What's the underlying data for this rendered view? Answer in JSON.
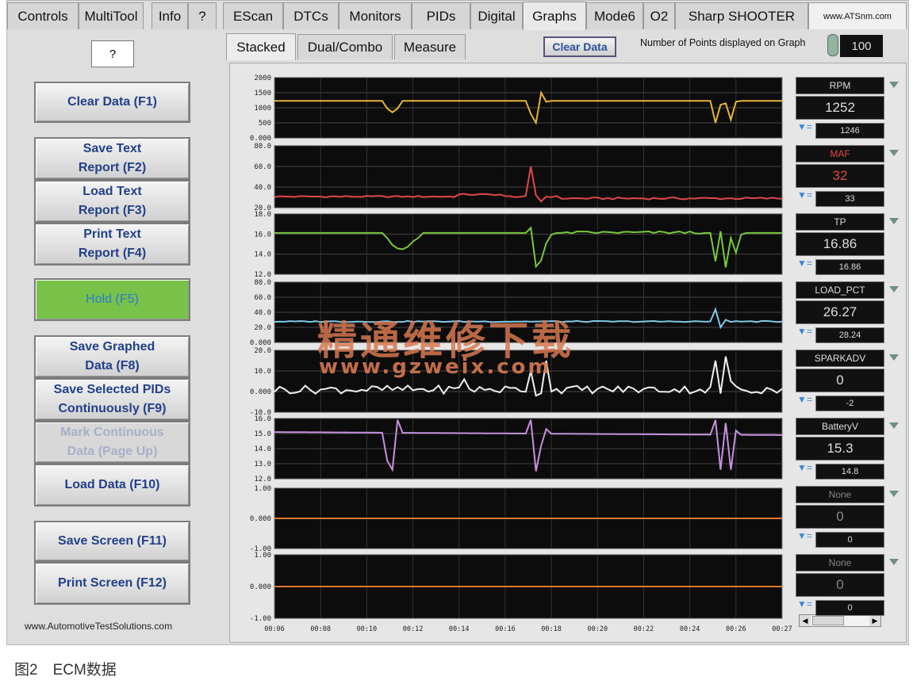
{
  "tabs": [
    "Controls",
    "MultiTool",
    "Info",
    "?",
    "EScan",
    "DTCs",
    "Monitors",
    "PIDs",
    "Digital",
    "Graphs",
    "Mode6",
    "O2",
    "Sharp SHOOTER",
    "www.ATSnm.com"
  ],
  "subtabs": [
    "Stacked",
    "Dual/Combo",
    "Measure"
  ],
  "clear_data_btn": "Clear Data",
  "points_label": "Number of Points displayed on Graph",
  "points_value": "100",
  "help_box": "?",
  "left_buttons": [
    "Clear Data (F1)",
    "Save Text\nReport (F2)",
    "Load Text\nReport (F3)",
    "Print Text\nReport (F4)",
    "Hold (F5)",
    "Save Graphed\nData (F8)",
    "Save Selected PIDs\nContinuously (F9)",
    "Mark Continuous\nData (Page Up)",
    "Load Data (F10)",
    "Save Screen (F11)",
    "Print Screen (F12)"
  ],
  "left_footer": "www.AutomotiveTestSolutions.com",
  "caption": "图2　ECM数据",
  "watermark_cn": "精通维修下载",
  "watermark_url": "www.gzweix.com",
  "pids": [
    {
      "name": "RPM",
      "value": "1252",
      "min": "1246",
      "color": "#e8b13a",
      "ticks": [
        "2000",
        "1500",
        "1000",
        "500",
        "0.000"
      ],
      "ymin": 0,
      "ymax": 2000,
      "line": [
        1200,
        1200,
        1200,
        1200,
        1200,
        1200,
        1200,
        1200,
        1200,
        1200,
        1200,
        1200,
        1200,
        1200,
        1200,
        1200,
        1200,
        1200,
        1200,
        1200,
        1200,
        1200,
        1200,
        1200,
        1200,
        1200,
        1200,
        1200,
        1200,
        1200,
        1200,
        1200,
        1200,
        1200,
        1200,
        1200,
        1200,
        1200,
        1200,
        1200,
        1200,
        1200,
        1200,
        1200,
        1200,
        1200,
        1200,
        1200,
        1200,
        1200,
        1200,
        1200,
        1200,
        1200,
        1200,
        1200,
        1200,
        1200,
        1200,
        1200,
        1200,
        1200,
        1200,
        1200,
        1200,
        1200,
        1200,
        1200,
        1200,
        1200,
        1200,
        1200,
        1200,
        1200,
        1200,
        1200,
        1200,
        1200,
        1200,
        1200,
        1200,
        1200,
        1200,
        1200,
        1200,
        1200,
        1200,
        1200,
        1200,
        1200,
        1200,
        1200,
        1200,
        1200,
        1200,
        1200,
        1200,
        1200,
        1200,
        1200
      ]
    },
    {
      "name": "MAF",
      "value": "32",
      "min": "33",
      "color": "#e04848",
      "ticks": [
        "80.0",
        "60.0",
        "40.0",
        "20.0"
      ],
      "ymin": 20,
      "ymax": 80
    },
    {
      "name": "TP",
      "value": "16.86",
      "min": "16.86",
      "color": "#78c83c",
      "ticks": [
        "18.0",
        "16.0",
        "14.0",
        "12.0"
      ],
      "ymin": 12,
      "ymax": 19
    },
    {
      "name": "LOAD_PCT",
      "value": "26.27",
      "min": "28.24",
      "color": "#7fc8e8",
      "ticks": [
        "80.0",
        "60.0",
        "40.0",
        "20.0",
        "0.000"
      ],
      "ymin": 0,
      "ymax": 80
    },
    {
      "name": "SPARKADV",
      "value": "0",
      "min": "-2",
      "color": "#f0f0f0",
      "ticks": [
        "20.0",
        "10.0",
        "0.000",
        "-10.0"
      ],
      "ymin": -10,
      "ymax": 20
    },
    {
      "name": "BatteryV",
      "value": "15.3",
      "min": "14.8",
      "color": "#c890e0",
      "ticks": [
        "16.0",
        "15.0",
        "14.0",
        "13.0",
        "12.0"
      ],
      "ymin": 12,
      "ymax": 16
    },
    {
      "name": "None",
      "value": "0",
      "min": "0",
      "color": "#e07830",
      "ticks": [
        "1.00",
        "0.000",
        "-1.00"
      ],
      "ymin": -1,
      "ymax": 1
    },
    {
      "name": "None",
      "value": "0",
      "min": "0",
      "color": "#e07830",
      "ticks": [
        "1.00",
        "0.000",
        "-1.00"
      ],
      "ymin": -1,
      "ymax": 1
    }
  ],
  "x_ticks": [
    "00:06",
    "00:08",
    "00:10",
    "00:12",
    "00:14",
    "00:16",
    "00:18",
    "00:20",
    "00:22",
    "00:24",
    "00:26",
    "00:27"
  ],
  "mark_symbol": "="
}
